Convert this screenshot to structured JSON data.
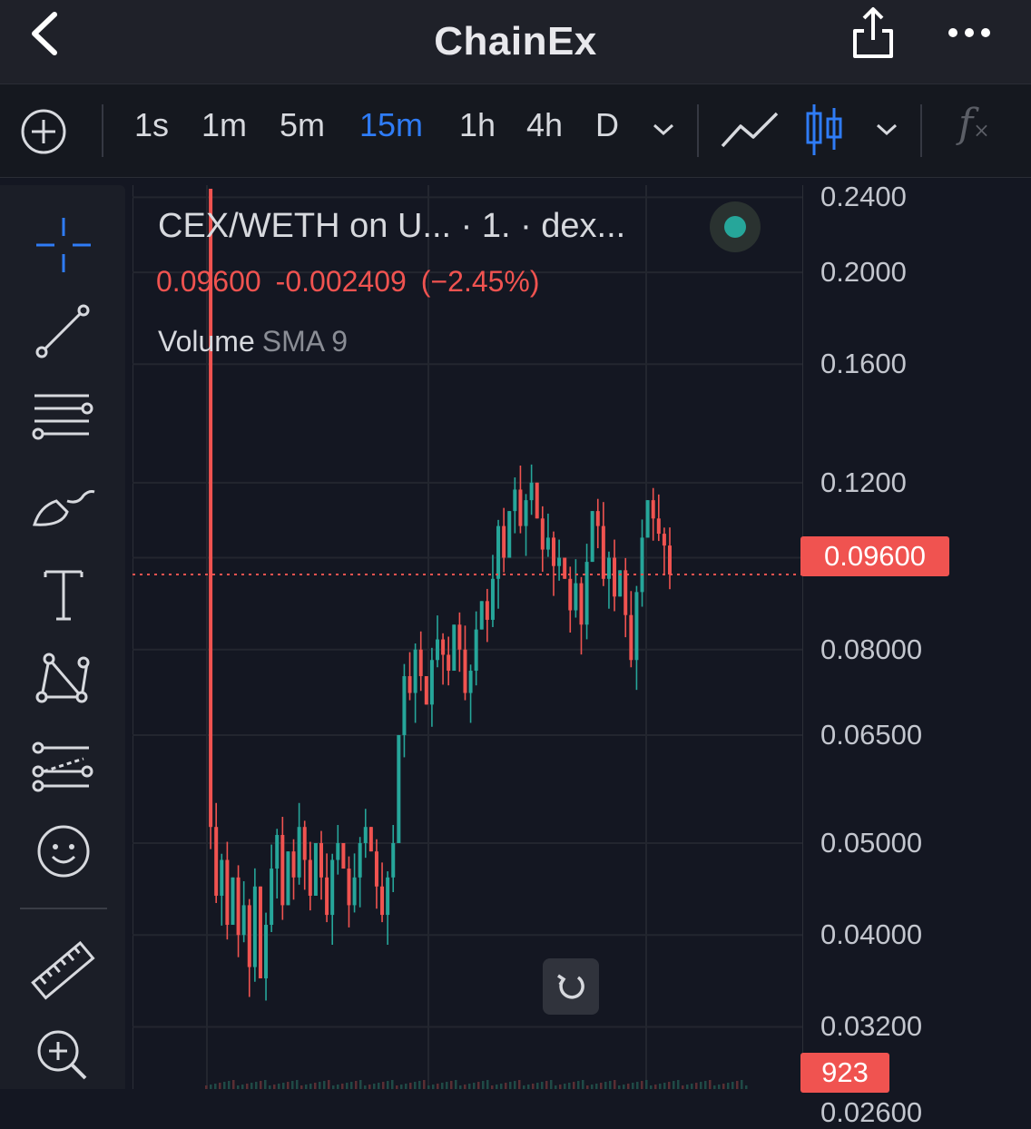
{
  "app": {
    "title": "ChainEx"
  },
  "icons": {
    "back": "chevron-left-icon",
    "share": "share-icon",
    "more": "more-horizontal-icon",
    "add": "plus-circle-icon",
    "line_chart": "line-chart-icon",
    "candles": "candlestick-icon",
    "indicators": "fx-icon",
    "crosshair": "crosshair-icon",
    "trend_line": "trend-line-icon",
    "horizontal_lines": "horizontal-lines-icon",
    "brush": "brush-icon",
    "text": "text-icon",
    "pattern": "pattern-icon",
    "forecast": "forecast-icon",
    "emoji": "smiley-icon",
    "ruler": "ruler-icon",
    "zoom": "zoom-in-icon",
    "reset": "reset-icon"
  },
  "toolbar": {
    "timeframes": [
      "1s",
      "1m",
      "5m",
      "15m",
      "1h",
      "4h",
      "D"
    ],
    "active_timeframe": "15m"
  },
  "legend": {
    "symbol": "CEX/WETH on U... · 1. · dex...",
    "last": "0.09600",
    "change": "-0.002409",
    "change_pct": "(−2.45%)",
    "volume_label": "Volume",
    "volume_sma": "SMA 9"
  },
  "colors": {
    "up": "#26a69a",
    "down": "#f05350",
    "accent": "#2f7cf6",
    "background": "#141722"
  },
  "chart_data": {
    "type": "candlestick",
    "ylim": [
      0.0285,
      0.245
    ],
    "y_scale": "log",
    "y_ticks": [
      "0.2400",
      "0.2000",
      "0.1600",
      "0.1200",
      "0.1000",
      "0.08000",
      "0.06500",
      "0.05000",
      "0.04000",
      "0.03200",
      "0.02600"
    ],
    "last_price_label": "0.09600",
    "volume_label": "923",
    "close_series": [
      0.245,
      0.052,
      0.044,
      0.048,
      0.041,
      0.046,
      0.04,
      0.043,
      0.037,
      0.045,
      0.036,
      0.041,
      0.047,
      0.051,
      0.043,
      0.049,
      0.046,
      0.052,
      0.048,
      0.044,
      0.05,
      0.046,
      0.042,
      0.048,
      0.05,
      0.047,
      0.043,
      0.046,
      0.05,
      0.052,
      0.049,
      0.045,
      0.042,
      0.046,
      0.05,
      0.065,
      0.075,
      0.072,
      0.08,
      0.075,
      0.07,
      0.078,
      0.082,
      0.079,
      0.076,
      0.085,
      0.08,
      0.072,
      0.076,
      0.084,
      0.09,
      0.086,
      0.095,
      0.108,
      0.1,
      0.112,
      0.118,
      0.108,
      0.115,
      0.12,
      0.11,
      0.102,
      0.105,
      0.098,
      0.1,
      0.095,
      0.088,
      0.094,
      0.085,
      0.099,
      0.112,
      0.108,
      0.095,
      0.1,
      0.091,
      0.097,
      0.087,
      0.078,
      0.092,
      0.105,
      0.115,
      0.11,
      0.106,
      0.103,
      0.096
    ]
  }
}
